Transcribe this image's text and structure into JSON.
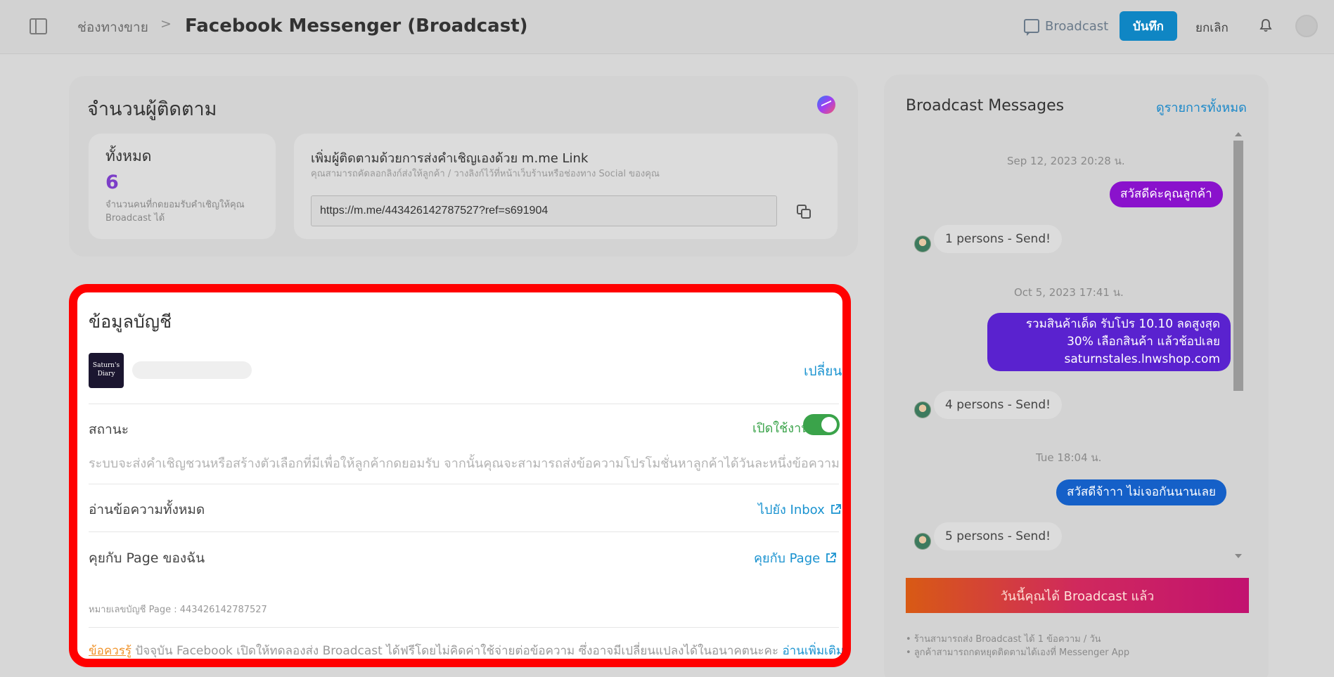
{
  "header": {
    "breadcrumb": "ช่องทางขาย",
    "breadcrumb_sep": ">",
    "title": "Facebook Messenger (Broadcast)",
    "broadcast_label": "Broadcast",
    "save_label": "บันทึก",
    "cancel_label": "ยกเลิก"
  },
  "followers": {
    "title": "จำนวนผู้ติดตาม",
    "total_label": "ทั้งหมด",
    "total_count": "6",
    "total_desc": "จำนวนคนที่กดยอมรับคำเชิญให้คุณ Broadcast ได้",
    "invite_title": "เพิ่มผู้ติดตามด้วยการส่งคำเชิญเองด้วย m.me Link",
    "invite_sub": "คุณสามารถคัดลอกลิงก์ส่งให้ลูกค้า / วางลิงก์ไว้ที่หน้าเว็บร้านหรือช่องทาง Social ของคุณ",
    "invite_link": "https://m.me/443426142787527?ref=s691904"
  },
  "account": {
    "title": "ข้อมูลบัญชี",
    "logo_text": "Saturn's Diary",
    "change_label": "เปลี่ยน",
    "status_label": "สถานะ",
    "status_value": "เปิดใช้งาน",
    "status_enabled": true,
    "status_desc": "ระบบจะส่งคำเชิญชวนหรือสร้างตัวเลือกที่มีเพื่อให้ลูกค้ากดยอมรับ จากนั้นคุณจะสามารถส่งข้อความโปรโมชั่นหาลูกค้าได้วันละหนึ่งข้อความ",
    "read_all_label": "อ่านข้อความทั้งหมด",
    "read_all_link": "ไปยัง Inbox",
    "chat_page_label": "คุยกับ Page ของฉัน",
    "chat_page_link": "คุยกับ Page",
    "page_id": "หมายเลขบัญชี Page : 443426142787527",
    "note_key": "ข้อควรรู้",
    "note_text": " ปัจจุบัน Facebook เปิดให้ทดลองส่ง Broadcast ได้ฟรีโดยไม่คิดค่าใช้จ่ายต่อข้อความ ซึ่งอาจมีเปลี่ยนแปลงได้ในอนาคตนะคะ ",
    "note_more": "อ่านเพิ่มเติม"
  },
  "broadcast": {
    "title": "Broadcast Messages",
    "view_all": "ดูรายการทั้งหมด",
    "messages": [
      {
        "date": "Sep 12, 2023 20:28 น.",
        "text": "สวัสดีค่ะคุณลูกค้า",
        "result": "1 persons - Send!",
        "color": "#8a12cc"
      },
      {
        "date": "Oct 5, 2023 17:41 น.",
        "text_lines": [
          "รวมสินค้าเด็ด รับโปร 10.10 ลดสูงสุด",
          "30% เลือกสินค้า แล้วช้อปเลย",
          "saturnstales.lnwshop.com"
        ],
        "result": "4 persons - Send!",
        "color": "#5a22cf"
      },
      {
        "date": "Tue 18:04 น.",
        "text": "สวัสดีจ้าาา ไม่เจอกันนานเลย",
        "result": "5 persons - Send!",
        "color": "#1560c8"
      }
    ],
    "cta": "วันนี้คุณได้ Broadcast แล้ว",
    "notes": [
      "ร้านสามารถส่ง Broadcast ได้ 1 ข้อความ / วัน",
      "ลูกค้าสามารถกดหยุดติดตามได้เองที่ Messenger App"
    ]
  }
}
